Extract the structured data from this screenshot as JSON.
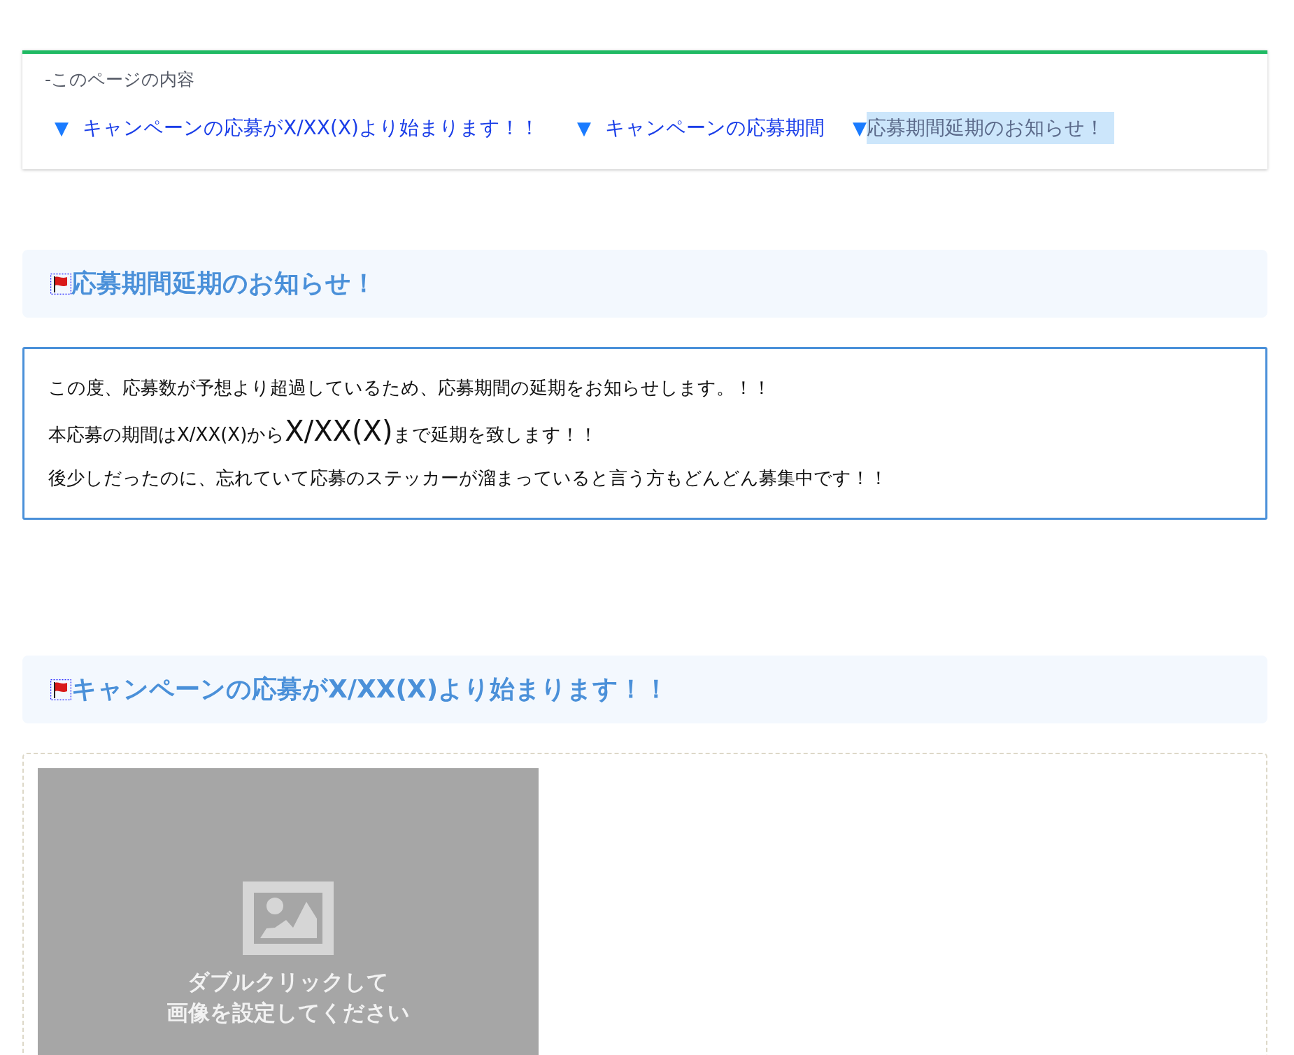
{
  "toc": {
    "title": "-このページの内容",
    "links": [
      {
        "marker": "▼",
        "label": "キャンペーンの応募がX/XX(X)より始まります！！",
        "highlighted": false
      },
      {
        "marker": "▼",
        "label": "キャンペーンの応募期間",
        "highlighted": false
      },
      {
        "marker": "▼",
        "label": "応募期間延期のお知らせ！",
        "highlighted": true
      }
    ]
  },
  "sections": [
    {
      "heading": "応募期間延期のお知らせ！",
      "kind": "text",
      "lines": [
        [
          {
            "text": "この度、応募数が予想より超過しているため、応募期間の延期をお知らせします。！！",
            "large": false
          }
        ],
        [
          {
            "text": "本応募の期間はX/XX(X)から",
            "large": false
          },
          {
            "text": "X/XX(X)",
            "large": true
          },
          {
            "text": "まで延期を致します！！",
            "large": false
          }
        ],
        [
          {
            "text": "後少しだったのに、忘れていて応募のステッカーが溜まっていると言う方もどんどん募集中です！！",
            "large": false
          }
        ]
      ]
    },
    {
      "heading": "キャンペーンの応募がX/XX(X)より始まります！！",
      "kind": "image",
      "placeholder": [
        "ダブルクリックして",
        "画像を設定してください"
      ]
    }
  ]
}
